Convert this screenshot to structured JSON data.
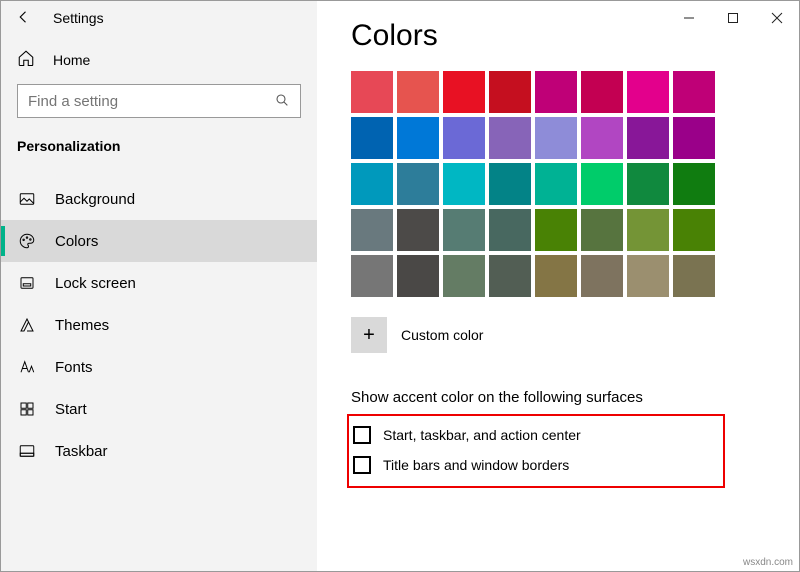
{
  "window": {
    "title": "Settings",
    "minimize": "Minimize",
    "maximize": "Maximize",
    "close": "Close"
  },
  "sidebar": {
    "home": "Home",
    "search_placeholder": "Find a setting",
    "section": "Personalization",
    "items": [
      {
        "label": "Background",
        "icon": "picture-icon",
        "selected": false
      },
      {
        "label": "Colors",
        "icon": "palette-icon",
        "selected": true
      },
      {
        "label": "Lock screen",
        "icon": "lockscreen-icon",
        "selected": false
      },
      {
        "label": "Themes",
        "icon": "themes-icon",
        "selected": false
      },
      {
        "label": "Fonts",
        "icon": "fonts-icon",
        "selected": false
      },
      {
        "label": "Start",
        "icon": "start-icon",
        "selected": false
      },
      {
        "label": "Taskbar",
        "icon": "taskbar-icon",
        "selected": false
      }
    ]
  },
  "content": {
    "heading": "Colors",
    "palette": [
      [
        "#e74856",
        "#e6544f",
        "#e81123",
        "#c50f1f",
        "#bf0077",
        "#c30052",
        "#e3008c",
        "#bf0077"
      ],
      [
        "#0063b1",
        "#0078d7",
        "#6b69d6",
        "#8764b8",
        "#8e8cd8",
        "#b146c2",
        "#881798",
        "#9a0089"
      ],
      [
        "#0099bc",
        "#2d7d9a",
        "#00b7c3",
        "#038387",
        "#00b294",
        "#00cc6a",
        "#10893e",
        "#107c10"
      ],
      [
        "#69797e",
        "#4c4a48",
        "#567c73",
        "#486860",
        "#498205",
        "#57743f",
        "#749436",
        "#498205"
      ],
      [
        "#767676",
        "#4a4846",
        "#647c64",
        "#525e54",
        "#847545",
        "#7e735f",
        "#9b8f6f",
        "#7a7351"
      ]
    ],
    "custom_color": "Custom color",
    "accent_label": "Show accent color on the following surfaces",
    "checks": [
      {
        "label": "Start, taskbar, and action center",
        "checked": false
      },
      {
        "label": "Title bars and window borders",
        "checked": false
      }
    ]
  },
  "watermark": "wsxdn.com"
}
